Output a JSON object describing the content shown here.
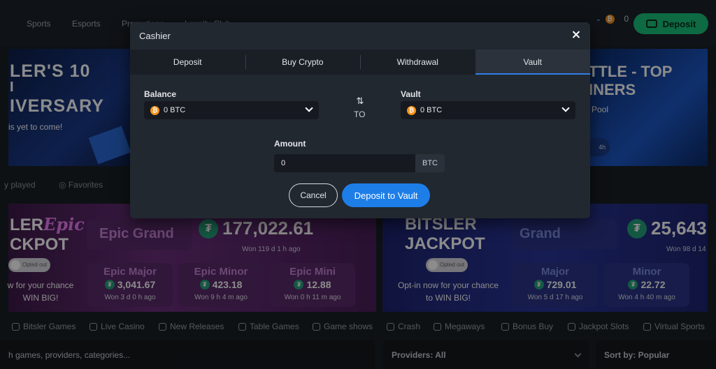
{
  "nav": {
    "items": [
      "Sports",
      "Esports",
      "Promotions",
      "Loyalty Club"
    ],
    "wallet_amount": "0",
    "deposit_label": "Deposit"
  },
  "banners": {
    "left_lines": [
      "LER'S 10",
      "I",
      "IVERSARY"
    ],
    "left_sub": "is yet to come!",
    "right_lines": [
      "TTLE - TOP",
      "INERS"
    ],
    "right_sub": "Pool",
    "right_tag": "4h"
  },
  "filters": [
    "y played",
    "Favorites"
  ],
  "jackpots": {
    "left": {
      "logo_prefix": "LER",
      "logo_word": "Epic",
      "logo_line2": "CKPOT",
      "opt_out": "Opted out",
      "cta": [
        "w for your chance",
        "WIN BIG!"
      ],
      "grand_name": "Epic Grand",
      "grand_amount": "177,022.61",
      "grand_won": "Won 119 d 1 h ago",
      "tiles": [
        {
          "name": "Epic Major",
          "amount": "3,041.67",
          "won": "Won 3 d 0 h ago"
        },
        {
          "name": "Epic Minor",
          "amount": "423.18",
          "won": "Won 9 h 4 m ago"
        },
        {
          "name": "Epic Mini",
          "amount": "12.88",
          "won": "Won 0 h 11 m ago"
        }
      ]
    },
    "right": {
      "logo_line1": "BITSLER",
      "logo_line2": "JACKPOT",
      "opt_out": "Opted out",
      "cta": [
        "Opt-in now for your chance",
        "to WIN BIG!"
      ],
      "grand_name": "Grand",
      "grand_amount": "25,643",
      "grand_won": "Won 98 d 14",
      "tiles": [
        {
          "name": "Major",
          "amount": "729.01",
          "won": "Won 5 d 17 h ago"
        },
        {
          "name": "Minor",
          "amount": "22.72",
          "won": "Won 4 h 40 m ago"
        }
      ]
    }
  },
  "categories": [
    "Bitsler Games",
    "Live Casino",
    "New Releases",
    "Table Games",
    "Game shows",
    "Crash",
    "Megaways",
    "Bonus Buy",
    "Jackpot Slots",
    "Virtual Sports"
  ],
  "search": {
    "placeholder": "h games, providers, categories...",
    "providers": "Providers: All",
    "sort": "Sort by: Popular"
  },
  "modal": {
    "title": "Cashier",
    "tabs": [
      "Deposit",
      "Buy Crypto",
      "Withdrawal",
      "Vault"
    ],
    "active_tab": "Vault",
    "balance_label": "Balance",
    "balance_value": "0 BTC",
    "to_label": "TO",
    "vault_label": "Vault",
    "vault_value": "0 BTC",
    "amount_label": "Amount",
    "amount_value": "0",
    "amount_unit": "BTC",
    "cancel_label": "Cancel",
    "submit_label": "Deposit to Vault"
  },
  "colors": {
    "accent_blue": "#1e7ee8",
    "deposit_green": "#18c27a",
    "btc_orange": "#f7931a",
    "tether_green": "#26a17b"
  }
}
